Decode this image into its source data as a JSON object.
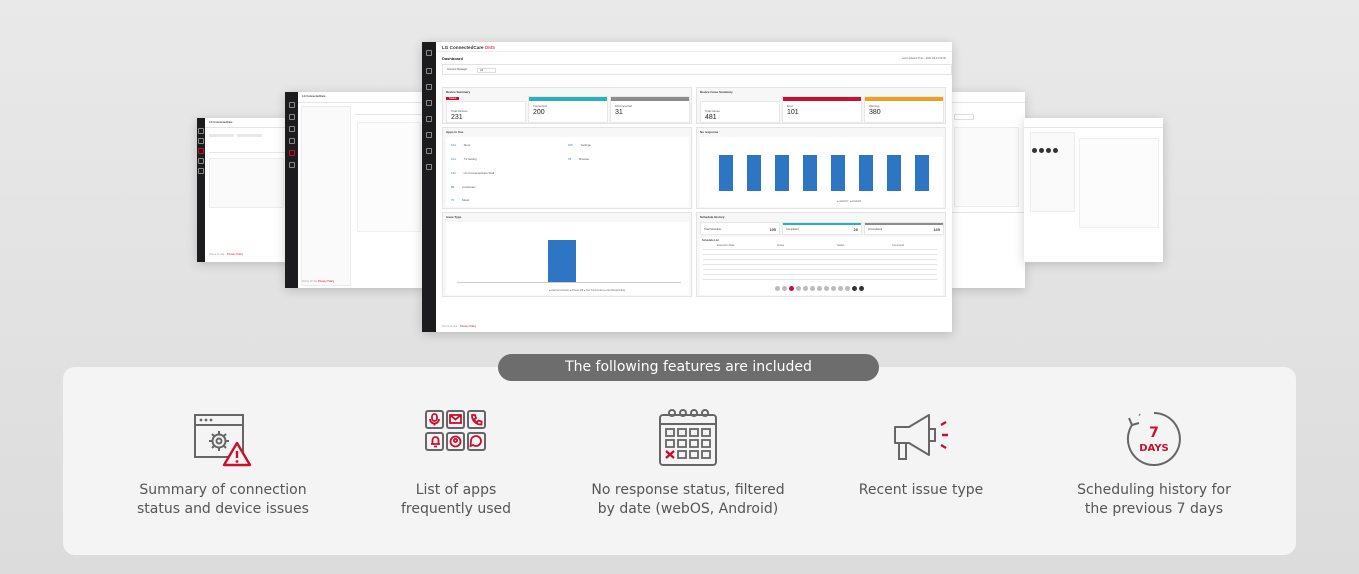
{
  "banner": "The following features are included",
  "features": [
    {
      "icon": "settings-warning-icon",
      "line1": "Summary of connection",
      "line2": "status and device issues"
    },
    {
      "icon": "app-grid-icon",
      "line1": "List of apps",
      "line2": "frequently used"
    },
    {
      "icon": "calendar-x-icon",
      "line1": "No response status, filtered",
      "line2": "by date (webOS, Android)"
    },
    {
      "icon": "megaphone-icon",
      "line1": "Recent issue type",
      "line2": ""
    },
    {
      "icon": "seven-days-icon",
      "line1": "Scheduling history for",
      "line2": "the previous 7 days",
      "badge_num": "7",
      "badge_unit": "DAYS"
    }
  ],
  "mockup": {
    "app_title": "LG ConnectedCare",
    "app_title_suffix": "DMS",
    "page_title": "Dashboard",
    "last_updated": "Last Updated Time : 2021.03.14 00:00",
    "filter_label": "Account Manager",
    "filter_value": "All",
    "device_summary": {
      "title": "Device Summary",
      "tag": "Status",
      "cards": [
        {
          "label": "Total Devices",
          "value": "231",
          "color": "#ffffff"
        },
        {
          "label": "Connected",
          "value": "200",
          "color": "#2bb0b8"
        },
        {
          "label": "Disconnected",
          "value": "31",
          "color": "#8c8c8c"
        }
      ]
    },
    "issue_summary": {
      "title": "Device Issue Summary",
      "cards": [
        {
          "label": "Total Issues",
          "value": "481",
          "color": "#ffffff"
        },
        {
          "label": "Error",
          "value": "101",
          "color": "#c8102e"
        },
        {
          "label": "Warning",
          "value": "380",
          "color": "#f0a020"
        }
      ]
    },
    "apps": {
      "title": "Apps in Use",
      "items": [
        {
          "count": "134",
          "name": "Store"
        },
        {
          "count": "124",
          "name": "TV Setting"
        },
        {
          "count": "120",
          "name": "LG ConnectedCare Staff"
        },
        {
          "count": "98",
          "name": "Livestream"
        },
        {
          "count": "76",
          "name": "Music"
        },
        {
          "count": "105",
          "name": "Settings"
        },
        {
          "count": "78",
          "name": "Browser"
        }
      ]
    },
    "no_response": {
      "title": "No response",
      "legend": [
        "webOS",
        "Android"
      ]
    },
    "issue_type": {
      "title": "Issue Type",
      "legend": [
        "Cannot Access",
        "Power Off",
        "Not Connected",
        "Not Responding"
      ]
    },
    "schedule": {
      "title": "Schedule History",
      "total_label": "Total Schedule",
      "total_value": "195",
      "completed_label": "Completed",
      "completed_value": "26",
      "incomplete_label": "Incompleted",
      "incomplete_value": "169",
      "list_title": "Schedule List",
      "columns": [
        "Execution Date",
        "Group",
        "Status",
        "Command"
      ]
    },
    "footer_links": [
      "Terms of Use",
      "Privacy Policy"
    ]
  }
}
